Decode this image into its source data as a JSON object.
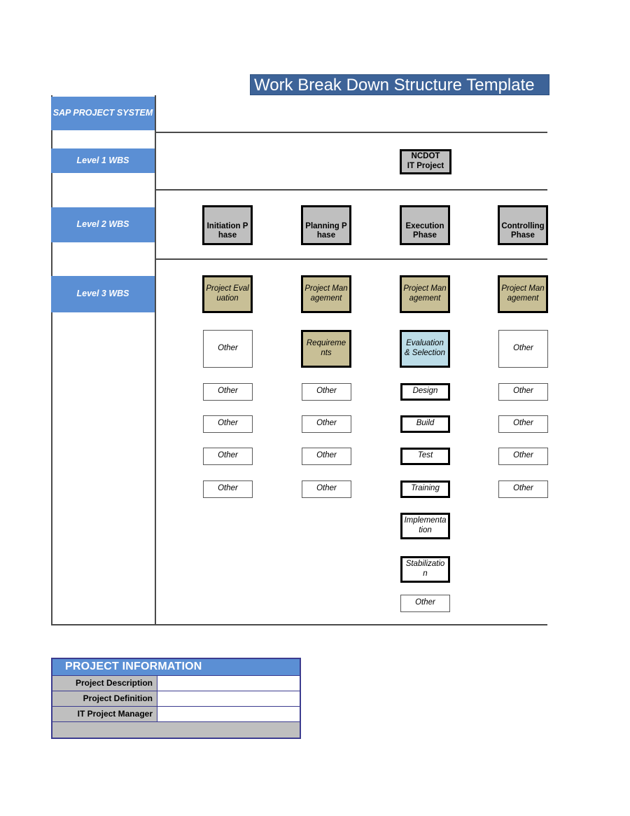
{
  "document": {
    "title": "Work Break Down Structure Template"
  },
  "sidebar": {
    "items": [
      {
        "label": "SAP PROJECT SYSTEM"
      },
      {
        "label": "Level 1 WBS"
      },
      {
        "label": "Level 2 WBS"
      },
      {
        "label": "Level 3 WBS"
      }
    ]
  },
  "wbs": {
    "level1": {
      "label": "NCDOT\nIT Project",
      "line1": "NCDOT",
      "line2": "IT Project",
      "fill": "#BFBFBF"
    },
    "level2": [
      {
        "label": "Initiation Phase",
        "fill": "#BFBFBF"
      },
      {
        "label": "Planning Phase",
        "fill": "#BFBFBF"
      },
      {
        "label": "Execution Phase",
        "fill": "#BFBFBF"
      },
      {
        "label": "Controlling Phase",
        "fill": "#BFBFBF"
      }
    ],
    "level3": {
      "column1": [
        {
          "label": "Project Evaluation",
          "fill": "#C8BF96",
          "border": "thick"
        },
        {
          "label": "Other",
          "fill": "#FFFFFF",
          "border": "thin"
        },
        {
          "label": "Other",
          "fill": "#FFFFFF",
          "border": "thin"
        },
        {
          "label": "Other",
          "fill": "#FFFFFF",
          "border": "thin"
        },
        {
          "label": "Other",
          "fill": "#FFFFFF",
          "border": "thin"
        },
        {
          "label": "Other",
          "fill": "#FFFFFF",
          "border": "thin"
        }
      ],
      "column2": [
        {
          "label": "Project Management",
          "fill": "#C8BF96",
          "border": "thick"
        },
        {
          "label": "Requirements",
          "fill": "#C8BF96",
          "border": "thick"
        },
        {
          "label": "Other",
          "fill": "#FFFFFF",
          "border": "thin"
        },
        {
          "label": "Other",
          "fill": "#FFFFFF",
          "border": "thin"
        },
        {
          "label": "Other",
          "fill": "#FFFFFF",
          "border": "thin"
        },
        {
          "label": "Other",
          "fill": "#FFFFFF",
          "border": "thin"
        }
      ],
      "column3": [
        {
          "label": "Project Management",
          "fill": "#C8BF96",
          "border": "thick"
        },
        {
          "label": "Evaluation & Selection",
          "fill": "#BCDDE8",
          "border": "thick"
        },
        {
          "label": "Design",
          "fill": "#FFFFFF",
          "border": "thick"
        },
        {
          "label": "Build",
          "fill": "#FFFFFF",
          "border": "thick"
        },
        {
          "label": "Test",
          "fill": "#FFFFFF",
          "border": "thick"
        },
        {
          "label": "Training",
          "fill": "#FFFFFF",
          "border": "thick"
        },
        {
          "label": "Implementation",
          "fill": "#FFFFFF",
          "border": "thick"
        },
        {
          "label": "Stabilization",
          "fill": "#FFFFFF",
          "border": "thick"
        },
        {
          "label": "Other",
          "fill": "#FFFFFF",
          "border": "thin"
        }
      ],
      "column4": [
        {
          "label": "Project Management",
          "fill": "#C8BF96",
          "border": "thick"
        },
        {
          "label": "Other",
          "fill": "#FFFFFF",
          "border": "thin"
        },
        {
          "label": "Other",
          "fill": "#FFFFFF",
          "border": "thin"
        },
        {
          "label": "Other",
          "fill": "#FFFFFF",
          "border": "thin"
        },
        {
          "label": "Other",
          "fill": "#FFFFFF",
          "border": "thin"
        },
        {
          "label": "Other",
          "fill": "#FFFFFF",
          "border": "thin"
        }
      ]
    }
  },
  "project_information": {
    "header": "PROJECT INFORMATION",
    "rows": [
      {
        "label": "Project Description",
        "value": ""
      },
      {
        "label": "Project Definition",
        "value": ""
      },
      {
        "label": "IT Project Manager",
        "value": ""
      }
    ]
  },
  "colors": {
    "accent_blue": "#5B8FD4",
    "title_blue": "#3D6398",
    "gray_fill": "#BFBFBF",
    "tan_fill": "#C8BF96",
    "lightblue_fill": "#BCDDE8",
    "table_border": "#3B3B8F"
  }
}
